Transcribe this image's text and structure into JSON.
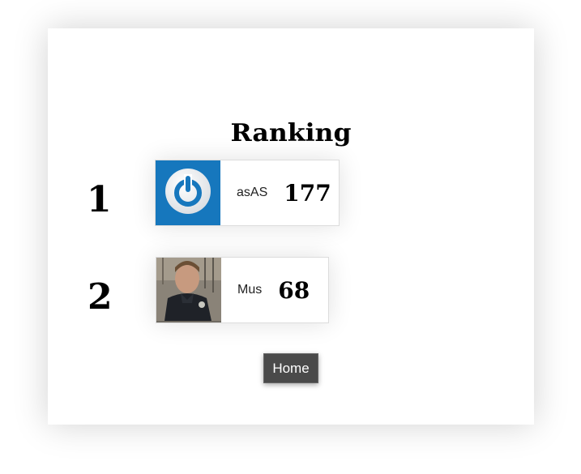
{
  "page": {
    "title": "Ranking"
  },
  "ranking": {
    "entries": [
      {
        "rank": "1",
        "username": "asAS",
        "score": "177",
        "avatar": "power-icon"
      },
      {
        "rank": "2",
        "username": "Mus",
        "score": "68",
        "avatar": "user-photo"
      }
    ]
  },
  "actions": {
    "home_label": "Home"
  },
  "colors": {
    "power_avatar_bg": "#1677bd",
    "home_button_bg": "#4a4a4a"
  }
}
